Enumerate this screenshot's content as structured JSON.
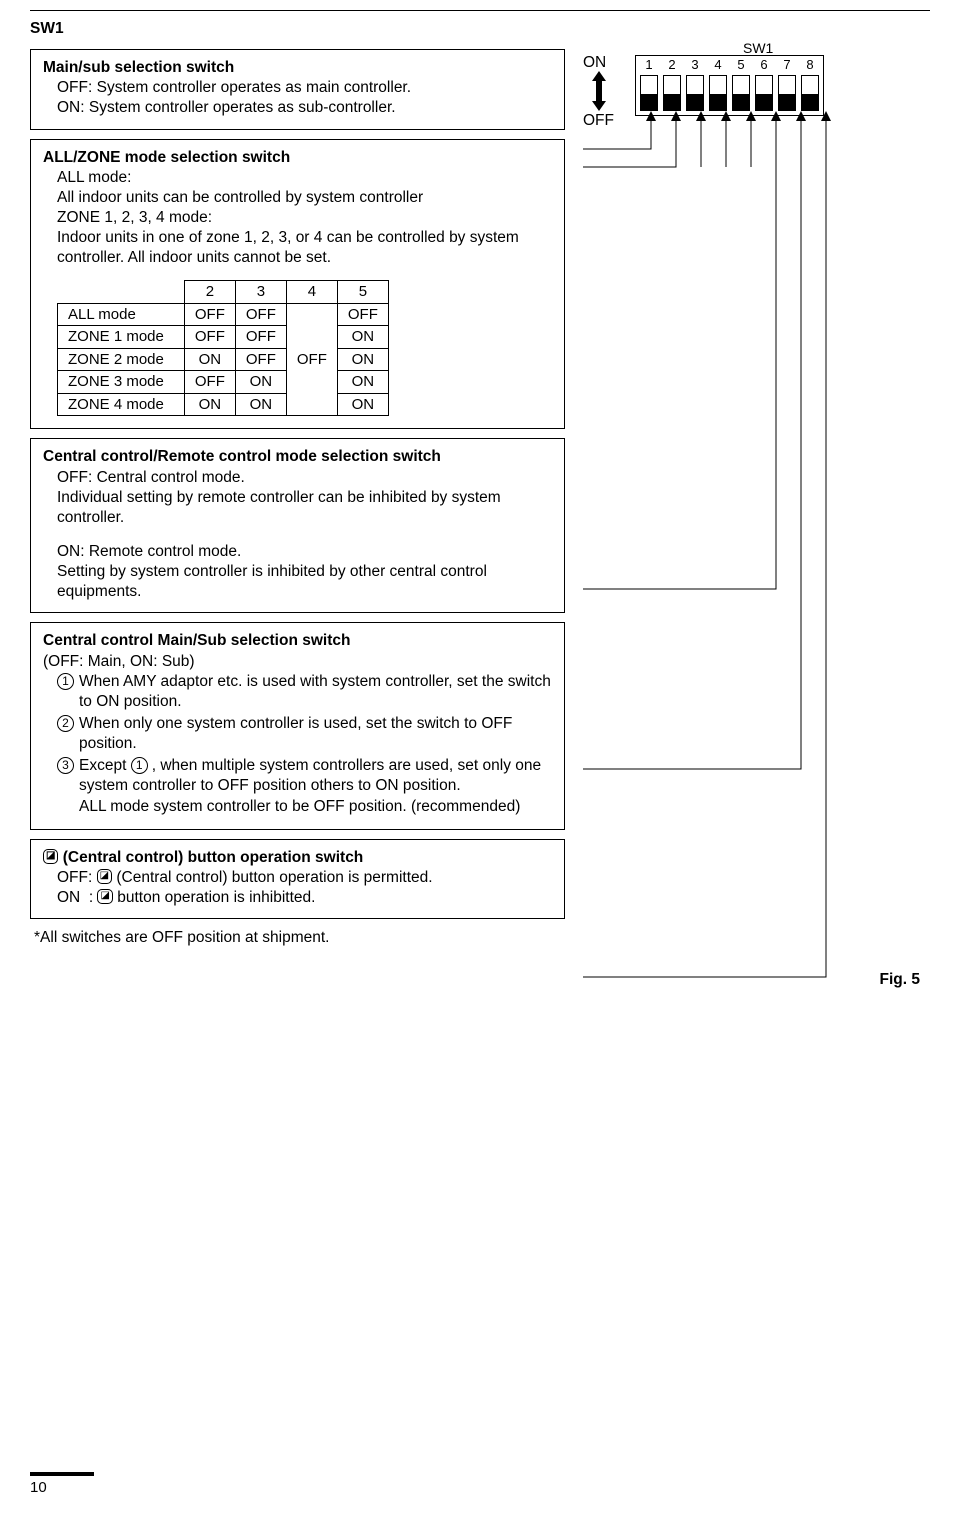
{
  "heading": "SW1",
  "box1": {
    "title": "Main/sub selection switch",
    "line1": "OFF: System controller operates as main controller.",
    "line2": "ON: System controller operates as sub-controller."
  },
  "box2": {
    "title": "ALL/ZONE mode selection switch",
    "para1_l1": "ALL mode:",
    "para1_l2": "All indoor units can be controlled by system controller",
    "para2_l1": "ZONE 1, 2, 3, 4 mode:",
    "para2_l2": "Indoor units in one of zone 1, 2, 3, or 4 can be controlled by system controller. All indoor units cannot be set.",
    "table": {
      "headers": [
        "2",
        "3",
        "4",
        "5"
      ],
      "rows": [
        {
          "label": "ALL mode",
          "c2": "OFF",
          "c3": "OFF",
          "c5": "OFF"
        },
        {
          "label": "ZONE 1 mode",
          "c2": "OFF",
          "c3": "OFF",
          "c5": "ON"
        },
        {
          "label": "ZONE 2 mode",
          "c2": "ON",
          "c3": "OFF",
          "c5": "ON"
        },
        {
          "label": "ZONE 3 mode",
          "c2": "OFF",
          "c3": "ON",
          "c5": "ON"
        },
        {
          "label": "ZONE 4 mode",
          "c2": "ON",
          "c3": "ON",
          "c5": "ON"
        }
      ],
      "col4_merged": "OFF"
    }
  },
  "box3": {
    "title": "Central control/Remote control mode selection switch",
    "l1": "OFF: Central control mode.",
    "l2": "Individual setting by remote controller can be inhibited by system controller.",
    "l3": "ON: Remote control mode.",
    "l4": "Setting by system controller is inhibited by other central control equipments."
  },
  "box4": {
    "title": "Central control Main/Sub selection switch",
    "sub": "(OFF: Main, ON: Sub)",
    "i1": "When AMY adaptor etc. is used with system controller, set the switch to ON position.",
    "i2": "When only one system controller is used, set the switch to OFF position.",
    "i3a": "Except ",
    "i3b": ", when multiple system controllers are used, set only one system controller to OFF position others to ON position.",
    "i3c": "ALL mode system controller to be OFF position. (recommended)"
  },
  "box5": {
    "title": " (Central control) button operation switch",
    "l1a": "OFF: ",
    "l1b": " (Central control) button operation is permitted.",
    "l2a": "ON  : ",
    "l2b": " button operation is inhibitted."
  },
  "note": "*All switches are OFF position at shipment.",
  "fig": "Fig. 5",
  "dip": {
    "title": "SW1",
    "on": "ON",
    "off": "OFF",
    "nums": [
      "1",
      "2",
      "3",
      "4",
      "5",
      "6",
      "7",
      "8"
    ]
  },
  "pagenum": "10"
}
